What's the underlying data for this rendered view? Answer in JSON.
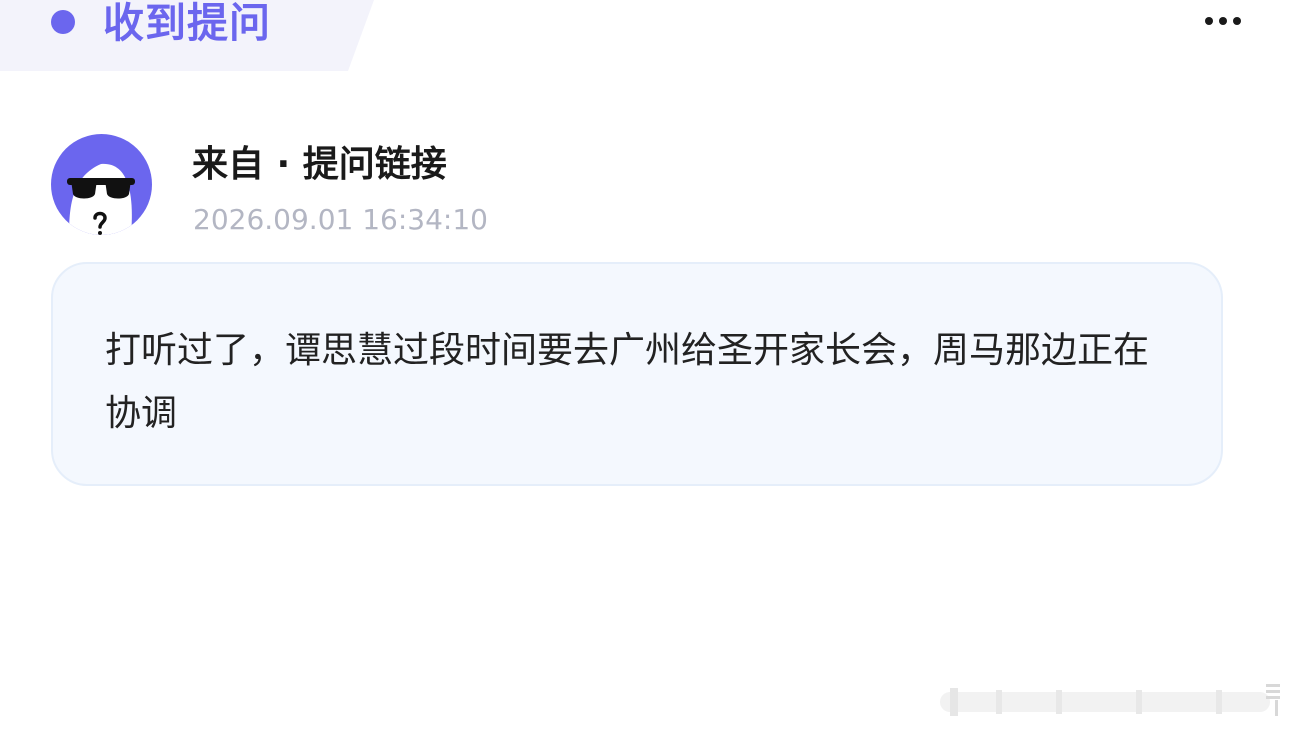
{
  "header": {
    "title": "收到提问",
    "accent_color": "#6b66ee",
    "more_icon": "more-dots-icon"
  },
  "sender": {
    "name": "来自 · 提问链接",
    "timestamp": "2026.09.01 16:34:10",
    "avatar_icon": "anonymous-sunglasses-avatar"
  },
  "message": {
    "text": "打听过了，谭思慧过段时间要去广州给圣开家长会，周马那边正在协调"
  }
}
